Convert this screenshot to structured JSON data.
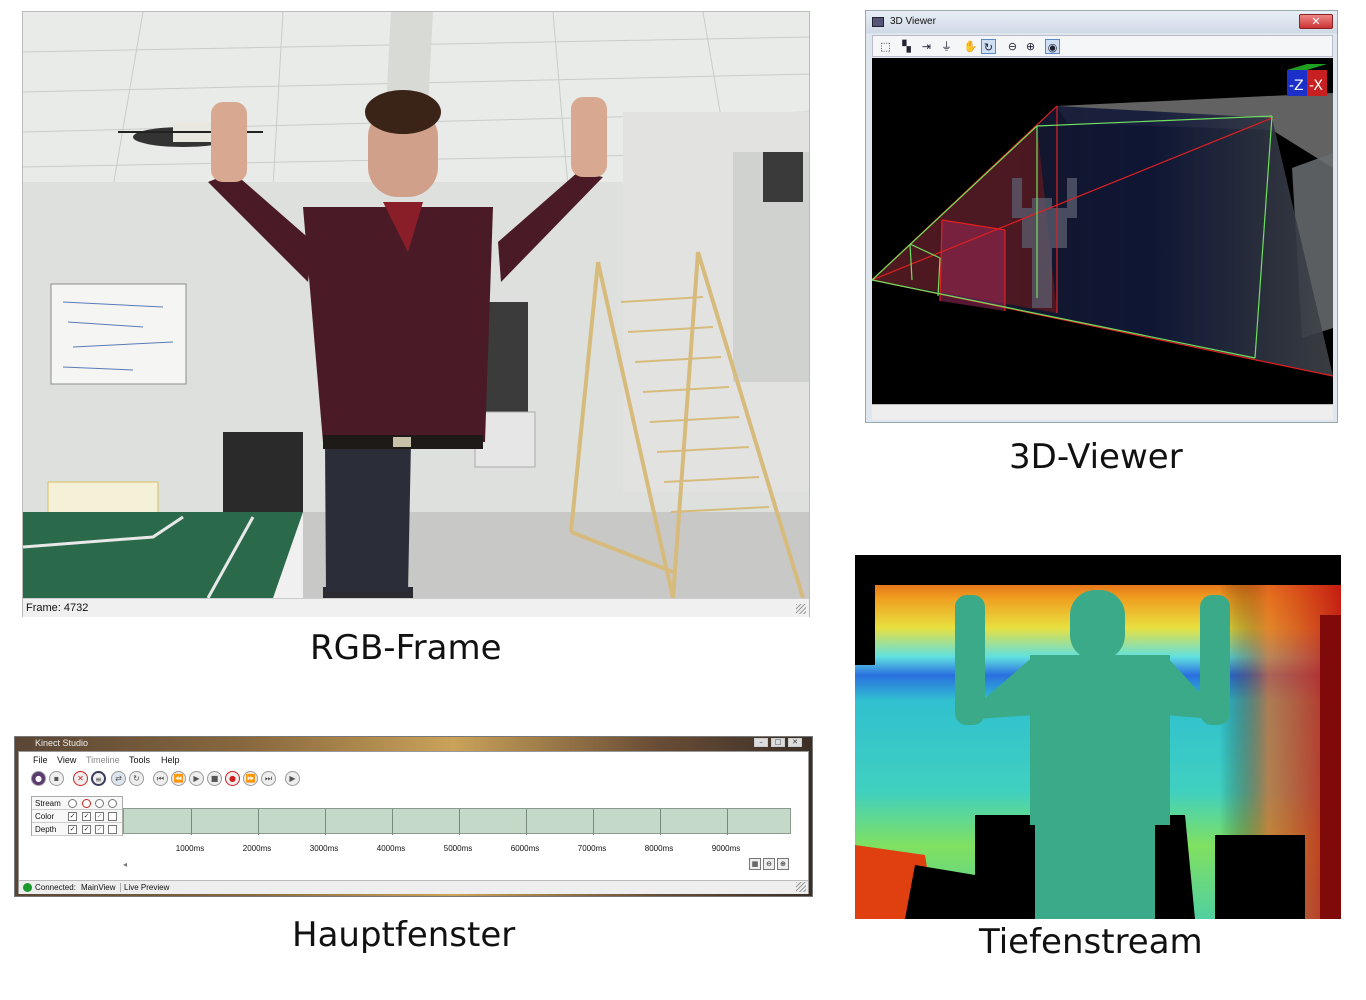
{
  "rgb_panel": {
    "status_text": "Frame: 4732",
    "caption": "RGB-Frame"
  },
  "viewer_panel": {
    "window_title": "3D Viewer",
    "close_glyph": "✕",
    "axis_gizmo": {
      "z_label": "-Z",
      "x_label": "-X"
    },
    "toolbar_icons": [
      "select-icon",
      "box-select-icon",
      "move-to-icon",
      "ground-icon",
      "pan-hand-icon",
      "rotate-icon",
      "zoom-out-icon",
      "zoom-in-icon",
      "camera-view-icon"
    ],
    "caption": "3D-Viewer"
  },
  "main_window": {
    "window_title": "Kinect Studio",
    "menu": [
      "File",
      "View",
      "Timeline",
      "Tools",
      "Help"
    ],
    "toolbar_icons": [
      "connect-icon",
      "save-icon",
      "disconnect-icon",
      "record-icon",
      "play-icon",
      "loop-icon",
      "skip-start-icon",
      "step-back-icon",
      "play-icon",
      "stop-icon",
      "record-icon",
      "step-forward-icon",
      "skip-end-icon",
      "play-end-icon"
    ],
    "streams": {
      "header": "Stream",
      "rows": [
        {
          "name": "Color",
          "checks": [
            "✓",
            "✓",
            "✓",
            ""
          ]
        },
        {
          "name": "Depth",
          "checks": [
            "✓",
            "✓",
            "✓",
            ""
          ]
        }
      ]
    },
    "timeline_labels": [
      "1000ms",
      "2000ms",
      "3000ms",
      "4000ms",
      "5000ms",
      "6000ms",
      "7000ms",
      "8000ms",
      "9000ms"
    ],
    "status": {
      "connected": "Connected:",
      "view": "MainView",
      "mode": "Live Preview"
    },
    "caption": "Hauptfenster"
  },
  "depth_panel": {
    "caption": "Tiefenstream"
  },
  "colors": {
    "frustum_red": "#e02020",
    "frustum_green": "#70e060",
    "record_red": "#d02020",
    "connected_green": "#1a9a2a"
  }
}
